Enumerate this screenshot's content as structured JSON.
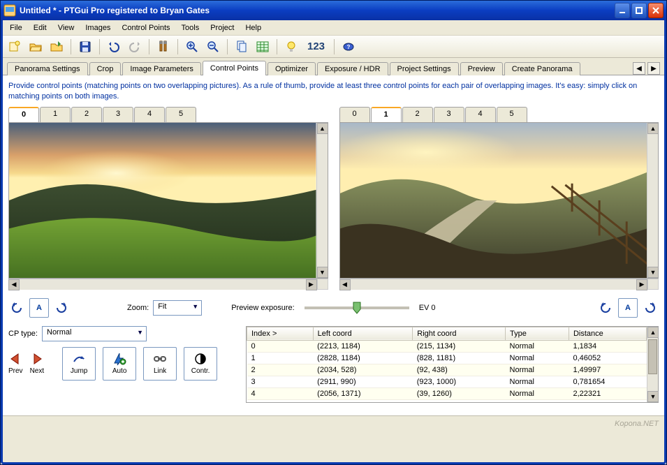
{
  "titlebar": {
    "text": "Untitled * - PTGui Pro registered to Bryan Gates"
  },
  "menu": [
    "File",
    "Edit",
    "View",
    "Images",
    "Control Points",
    "Tools",
    "Project",
    "Help"
  ],
  "toolbar": {
    "number_label": "123"
  },
  "tabs": [
    "Panorama Settings",
    "Crop",
    "Image Parameters",
    "Control Points",
    "Optimizer",
    "Exposure / HDR",
    "Project Settings",
    "Preview",
    "Create Panorama"
  ],
  "active_tab": "Control Points",
  "instructions": "Provide control points (matching points on two overlapping pictures). As a rule of thumb, provide at least three control points for each pair of overlapping images. It's easy: simply click on matching points on both images.",
  "left_pane": {
    "tabs": [
      "0",
      "1",
      "2",
      "3",
      "4",
      "5"
    ],
    "active": "0"
  },
  "right_pane": {
    "tabs": [
      "0",
      "1",
      "2",
      "3",
      "4",
      "5"
    ],
    "active": "1"
  },
  "controls": {
    "zoom_label": "Zoom:",
    "zoom_value": "Fit",
    "preview_exposure_label": "Preview exposure:",
    "ev_label": "EV 0",
    "rotate_a": "A",
    "cp_type_label": "CP type:",
    "cp_type_value": "Normal",
    "prev": "Prev",
    "next": "Next",
    "jump": "Jump",
    "auto": "Auto",
    "link": "Link",
    "contr": "Contr."
  },
  "table": {
    "headers": [
      "Index >",
      "Left coord",
      "Right coord",
      "Type",
      "Distance"
    ],
    "rows": [
      {
        "index": "0",
        "left": "(2213, 1184)",
        "right": "(215, 1134)",
        "type": "Normal",
        "dist": "1,1834"
      },
      {
        "index": "1",
        "left": "(2828, 1184)",
        "right": "(828, 1181)",
        "type": "Normal",
        "dist": "0,46052"
      },
      {
        "index": "2",
        "left": "(2034, 528)",
        "right": "(92, 438)",
        "type": "Normal",
        "dist": "1,49997"
      },
      {
        "index": "3",
        "left": "(2911, 990)",
        "right": "(923, 1000)",
        "type": "Normal",
        "dist": "0,781654"
      },
      {
        "index": "4",
        "left": "(2056, 1371)",
        "right": "(39, 1260)",
        "type": "Normal",
        "dist": "2,22321"
      }
    ]
  },
  "watermark": "Kopona.NET"
}
